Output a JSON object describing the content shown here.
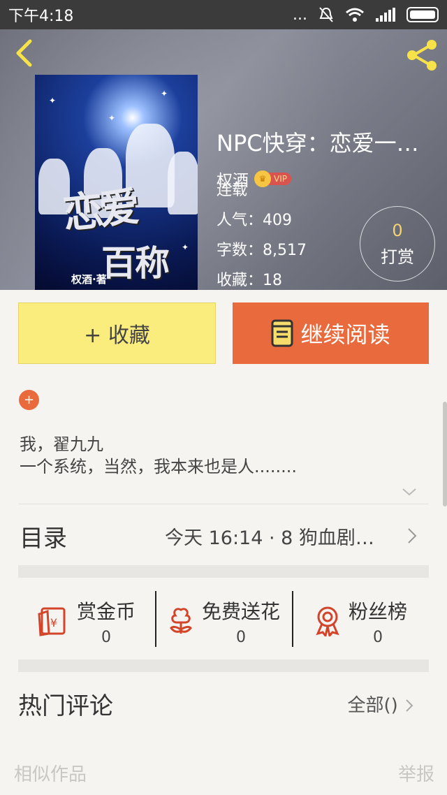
{
  "status_bar": {
    "time": "下午4:18",
    "dots": "...",
    "signal": "signal-icon",
    "wifi": "wifi-icon",
    "battery": "battery-icon"
  },
  "header": {
    "book_title": "NPC快穿：恋爱一…",
    "author": "权酒",
    "vip_label": "VIP",
    "status": "连载",
    "popularity_label": "人气：",
    "popularity_value": "409",
    "words_label": "字数：",
    "words_value": "8,517",
    "favorites_label": "收藏：",
    "favorites_value": "18",
    "tip_count": "0",
    "tip_label": "打赏",
    "cover_text_1": "恋爱",
    "cover_text_2": "百称",
    "cover_author": "权酒·著"
  },
  "actions": {
    "collect_label": "+ 收藏",
    "read_label": "继续阅读"
  },
  "intro": {
    "line1": "我，翟九九",
    "line2": "一个系统，当然，我本来也是人........"
  },
  "toc": {
    "label": "目录",
    "latest": "今天 16:14 · 8 狗血剧…"
  },
  "stats": [
    {
      "name": "赏金币",
      "value": "0",
      "icon": "reward-coin-icon"
    },
    {
      "name": "免费送花",
      "value": "0",
      "icon": "flower-icon"
    },
    {
      "name": "粉丝榜",
      "value": "0",
      "icon": "fan-rank-icon"
    }
  ],
  "comments": {
    "title": "热门评论",
    "all_label": "全部()"
  },
  "footer": {
    "similar": "相似作品",
    "report": "举报"
  },
  "colors": {
    "accent_orange": "#e96a3c",
    "collect_yellow": "#faed7d",
    "icon_red": "#d2452b",
    "tip_gold": "#f3d373"
  }
}
